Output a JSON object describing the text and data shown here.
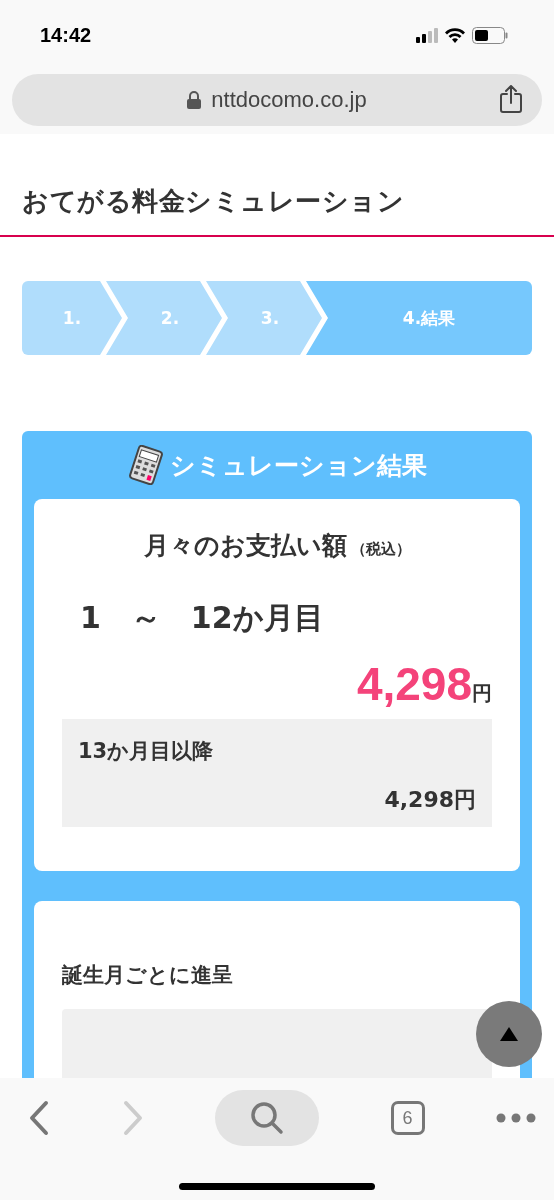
{
  "status_bar": {
    "time": "14:42"
  },
  "address_bar": {
    "url": "nttdocomo.co.jp"
  },
  "page_title": "おてがる料金シミュレーション",
  "steps": [
    {
      "label": "1.",
      "selected": false
    },
    {
      "label": "2.",
      "selected": false
    },
    {
      "label": "3.",
      "selected": false
    },
    {
      "label": "4.結果",
      "selected": true
    }
  ],
  "result": {
    "title": "シミュレーション結果",
    "monthly_label": "月々のお支払い額",
    "tax_note": "（税込）",
    "period": "1　～　12か月目",
    "amount": "4,298",
    "unit": "円",
    "after_label": "13か月目以降",
    "after_amount": "4,298円"
  },
  "next_section": {
    "heading": "誕生月ごとに進呈"
  },
  "toolbar": {
    "back_disabled": false,
    "forward_disabled": true,
    "tab_count": "6"
  }
}
